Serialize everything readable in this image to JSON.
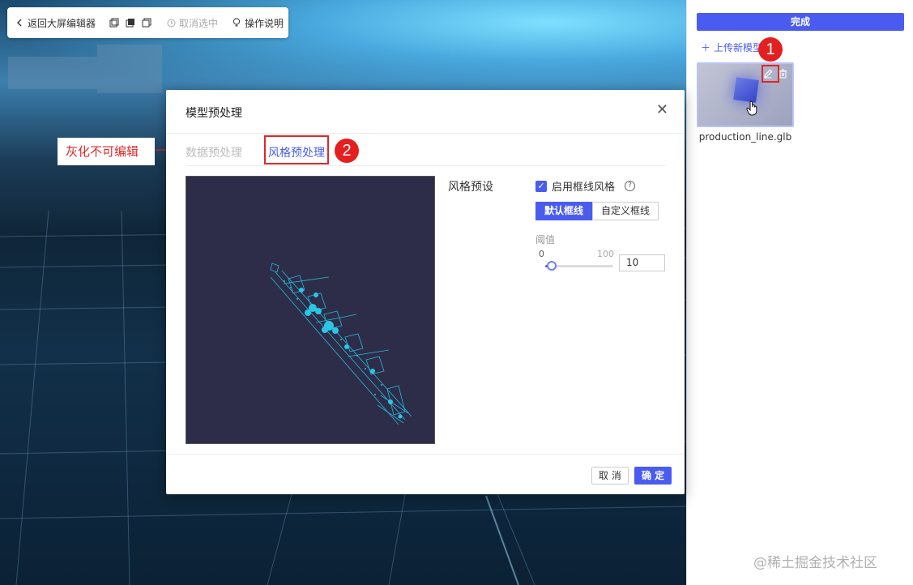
{
  "toolbar": {
    "back_label": "返回大屏编辑器",
    "cancel_select_label": "取消选中",
    "help_label": "操作说明"
  },
  "right_panel": {
    "done_label": "完成",
    "upload_label": "上传新模型",
    "model_file_name": "production_line.glb"
  },
  "modal": {
    "title": "模型预处理",
    "tabs": [
      {
        "label": "数据预处理",
        "state": "disabled"
      },
      {
        "label": "风格预处理",
        "state": "active"
      }
    ],
    "style_preset_label": "风格预设",
    "enable_wireframe_label": "启用框线风格",
    "enable_wireframe_checked": true,
    "segment": {
      "default_label": "默认框线",
      "custom_label": "自定义框线",
      "selected": "default"
    },
    "threshold": {
      "label": "阈值",
      "min_label": "0",
      "max_label": "100",
      "min": 0,
      "max": 100,
      "value": 10,
      "input_value": "10"
    },
    "cancel_label": "取 消",
    "ok_label": "确 定"
  },
  "annotations": {
    "gray_note": "灰化不可编辑",
    "badge_1": "1",
    "badge_2": "2"
  },
  "watermark": "@稀土掘金技术社区",
  "colors": {
    "primary": "#4a5cf0",
    "annotation_red": "#e02727",
    "preview_bg": "#2d2d49",
    "wireframe": "#2ac6e6"
  }
}
